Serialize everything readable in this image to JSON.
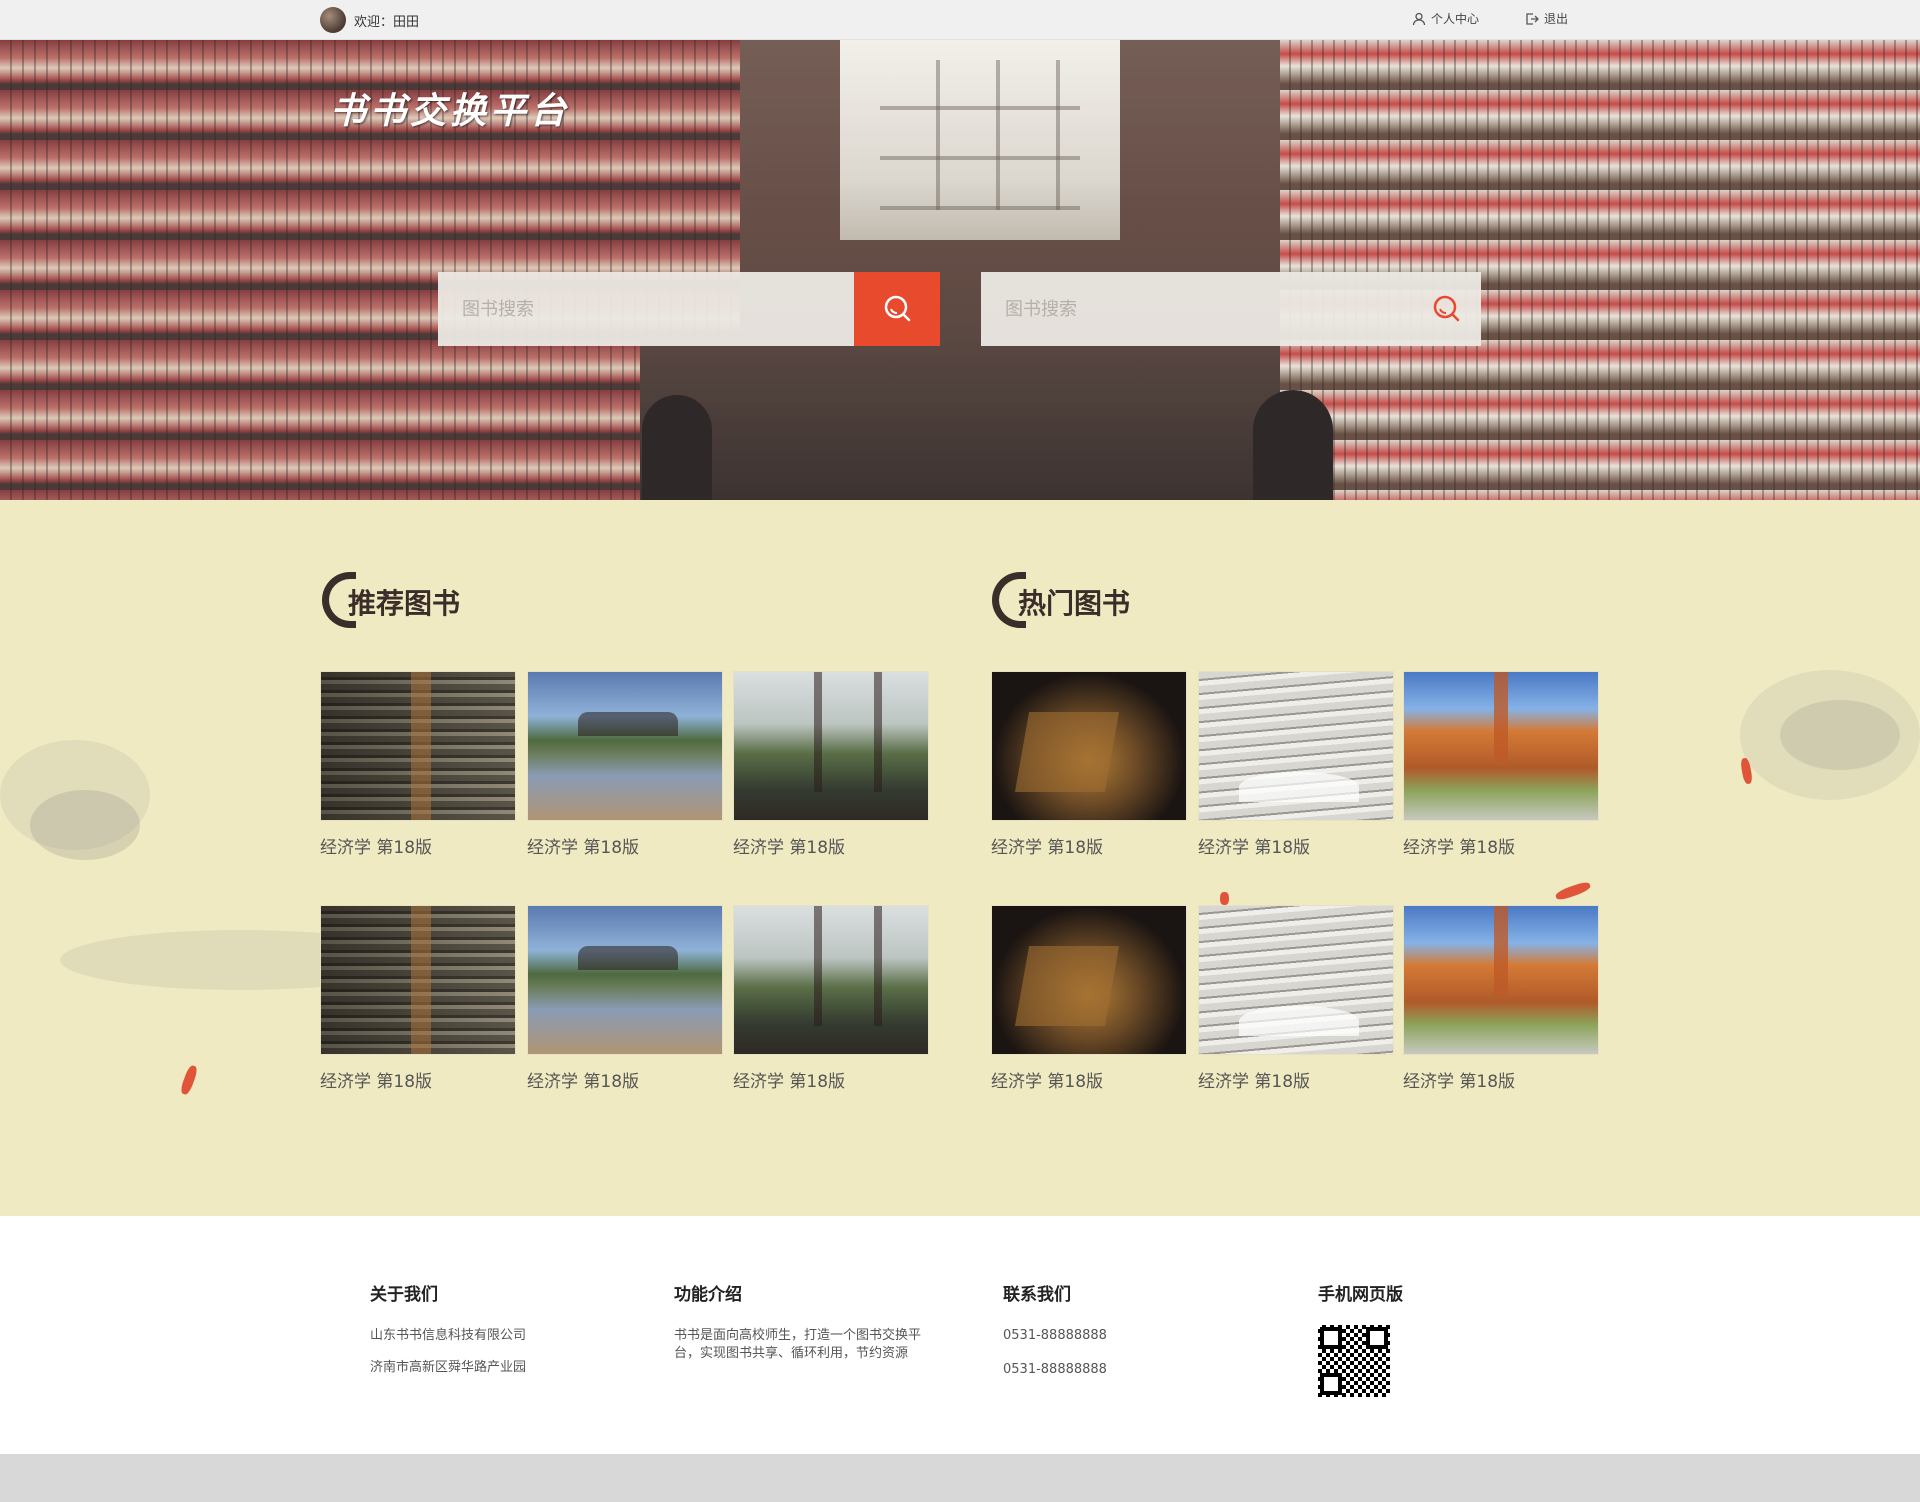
{
  "topbar": {
    "welcome": "欢迎：田田",
    "personal_center": "个人中心",
    "logout": "退出"
  },
  "hero": {
    "site_title": "书书交换平台",
    "search1_placeholder": "图书搜索",
    "search2_placeholder": "图书搜索"
  },
  "recommended": {
    "title": "推荐图书",
    "books": [
      {
        "caption": "经济学 第18版",
        "icon": "book-cover-1"
      },
      {
        "caption": "经济学 第18版",
        "icon": "book-cover-2"
      },
      {
        "caption": "经济学 第18版",
        "icon": "book-cover-3"
      },
      {
        "caption": "经济学 第18版",
        "icon": "book-cover-1"
      },
      {
        "caption": "经济学 第18版",
        "icon": "book-cover-2"
      },
      {
        "caption": "经济学 第18版",
        "icon": "book-cover-3"
      }
    ]
  },
  "hot": {
    "title": "热门图书",
    "books": [
      {
        "caption": "经济学 第18版",
        "icon": "book-cover-4"
      },
      {
        "caption": "经济学 第18版",
        "icon": "book-cover-5"
      },
      {
        "caption": "经济学 第18版",
        "icon": "book-cover-6"
      },
      {
        "caption": "经济学 第18版",
        "icon": "book-cover-4"
      },
      {
        "caption": "经济学 第18版",
        "icon": "book-cover-5"
      },
      {
        "caption": "经济学 第18版",
        "icon": "book-cover-6"
      }
    ]
  },
  "footer": {
    "about": {
      "title": "关于我们",
      "lines": [
        "山东书书信息科技有限公司",
        "济南市高新区舜华路产业园"
      ]
    },
    "features": {
      "title": "功能介绍",
      "text": "书书是面向高校师生，打造一个图书交换平台，实现图书共享、循环利用，节约资源"
    },
    "contact": {
      "title": "联系我们",
      "lines": [
        "0531-88888888",
        "0531-88888888"
      ]
    },
    "mobile": {
      "title": "手机网页版"
    }
  },
  "colors": {
    "accent": "#e84a2e",
    "main_bg": "#efeac1"
  }
}
